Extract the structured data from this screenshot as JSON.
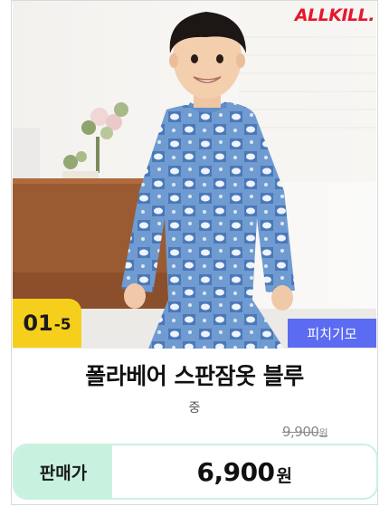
{
  "brand": {
    "logo_text": "ALLKILL."
  },
  "product": {
    "image_alt": "child wearing blue polar bear print pajamas",
    "age_badge": {
      "range": "01",
      "suffix": "-5"
    },
    "fabric_badge": "피치기모",
    "title": "폴라베어 스판잠옷 블루",
    "size": "중",
    "original_price": {
      "amount": "9,900",
      "unit": "원"
    },
    "sale": {
      "label": "판매가",
      "amount": "6,900",
      "unit": "원"
    }
  },
  "colors": {
    "brand_red": "#e8162b",
    "age_badge": "#f5cf1c",
    "fabric_badge": "#5b6cf2",
    "price_accent": "#c8f2df"
  }
}
